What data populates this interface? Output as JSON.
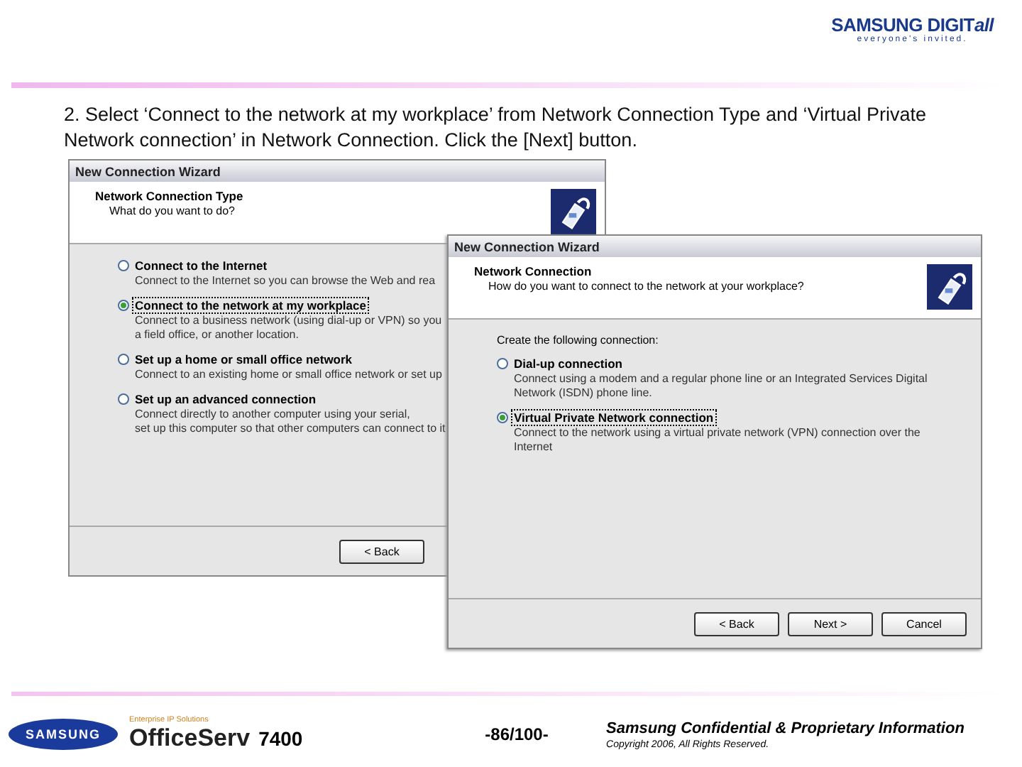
{
  "header": {
    "logo": "SAMSUNG DIGIT",
    "logo_suffix": "all",
    "tagline": "everyone's invited."
  },
  "instruction": "2. Select ‘Connect to the network at my workplace’ from Network Connection Type and ‘Virtual Private Network connection’ in Network Connection. Click the [Next] button.",
  "windows": [
    {
      "title": "New Connection Wizard",
      "heading": "Network Connection Type",
      "subheading": "What do you want to do?",
      "options": [
        {
          "label": "Connect to the Internet",
          "description": "Connect to the Internet so you can browse the Web and rea",
          "selected": false
        },
        {
          "label": "Connect to the network at my workplace",
          "description": "Connect to a business network (using dial-up or VPN) so you\na field office, or another location.",
          "selected": true
        },
        {
          "label": "Set up a home or small office network",
          "description": "Connect to an existing home or small office network or set up",
          "selected": false
        },
        {
          "label": "Set up an advanced connection",
          "description": "Connect directly to another computer using your serial,\nset up this computer so that other computers can connect to it",
          "selected": false
        }
      ],
      "buttons": [
        "< Back"
      ]
    },
    {
      "title": "New Connection Wizard",
      "heading": "Network Connection",
      "subheading": "How do you want to connect to the network at your workplace?",
      "intro": "Create the following connection:",
      "options": [
        {
          "label": "Dial-up connection",
          "description": "Connect using a modem and a regular phone line or an Integrated Services Digital Network (ISDN) phone line.",
          "selected": false
        },
        {
          "label": "Virtual Private Network connection",
          "description": "Connect to the network using a virtual private network (VPN) connection over the Internet",
          "selected": true
        }
      ],
      "buttons": [
        "< Back",
        "Next >",
        "Cancel"
      ]
    }
  ],
  "footer": {
    "brand": "SAMSUNG",
    "product_line": "Enterprise IP Solutions",
    "product": "OfficeServ",
    "model": "7400",
    "page": "-86/100-",
    "confidential": "Samsung Confidential & Proprietary Information",
    "copyright": "Copyright 2006, All Rights Reserved."
  }
}
